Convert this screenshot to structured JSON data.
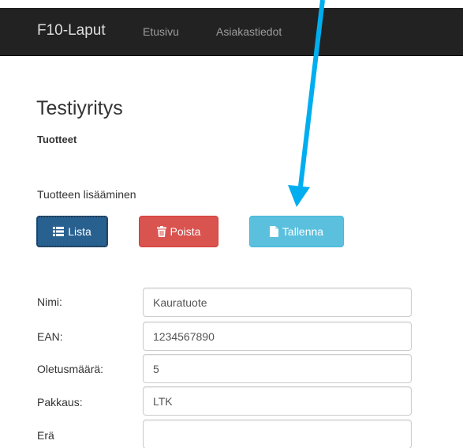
{
  "navbar": {
    "brand": "F10-Laput",
    "links": [
      "Etusivu",
      "Asiakastiedot"
    ]
  },
  "main": {
    "company_title": "Testiyritys",
    "section_title": "Tuotteet",
    "add_title": "Tuotteen lisääminen"
  },
  "toolbar": {
    "list_label": "Lista",
    "delete_label": "Poista",
    "save_label": "Tallenna"
  },
  "form": {
    "fields": [
      {
        "label": "Nimi:",
        "value": "Kauratuote"
      },
      {
        "label": "EAN:",
        "value": "1234567890"
      },
      {
        "label": "Oletusmäärä:",
        "value": "5"
      },
      {
        "label": "Pakkaus:",
        "value": "LTK"
      },
      {
        "label": "Erä",
        "value": ""
      }
    ]
  },
  "colors": {
    "navbar": "#222222",
    "primary": "#286090",
    "danger": "#d9534f",
    "info": "#5bc0de",
    "annotation_arrow": "#00aeef"
  },
  "icons": {
    "list": "list-icon",
    "delete": "trash-icon",
    "save": "file-icon"
  }
}
